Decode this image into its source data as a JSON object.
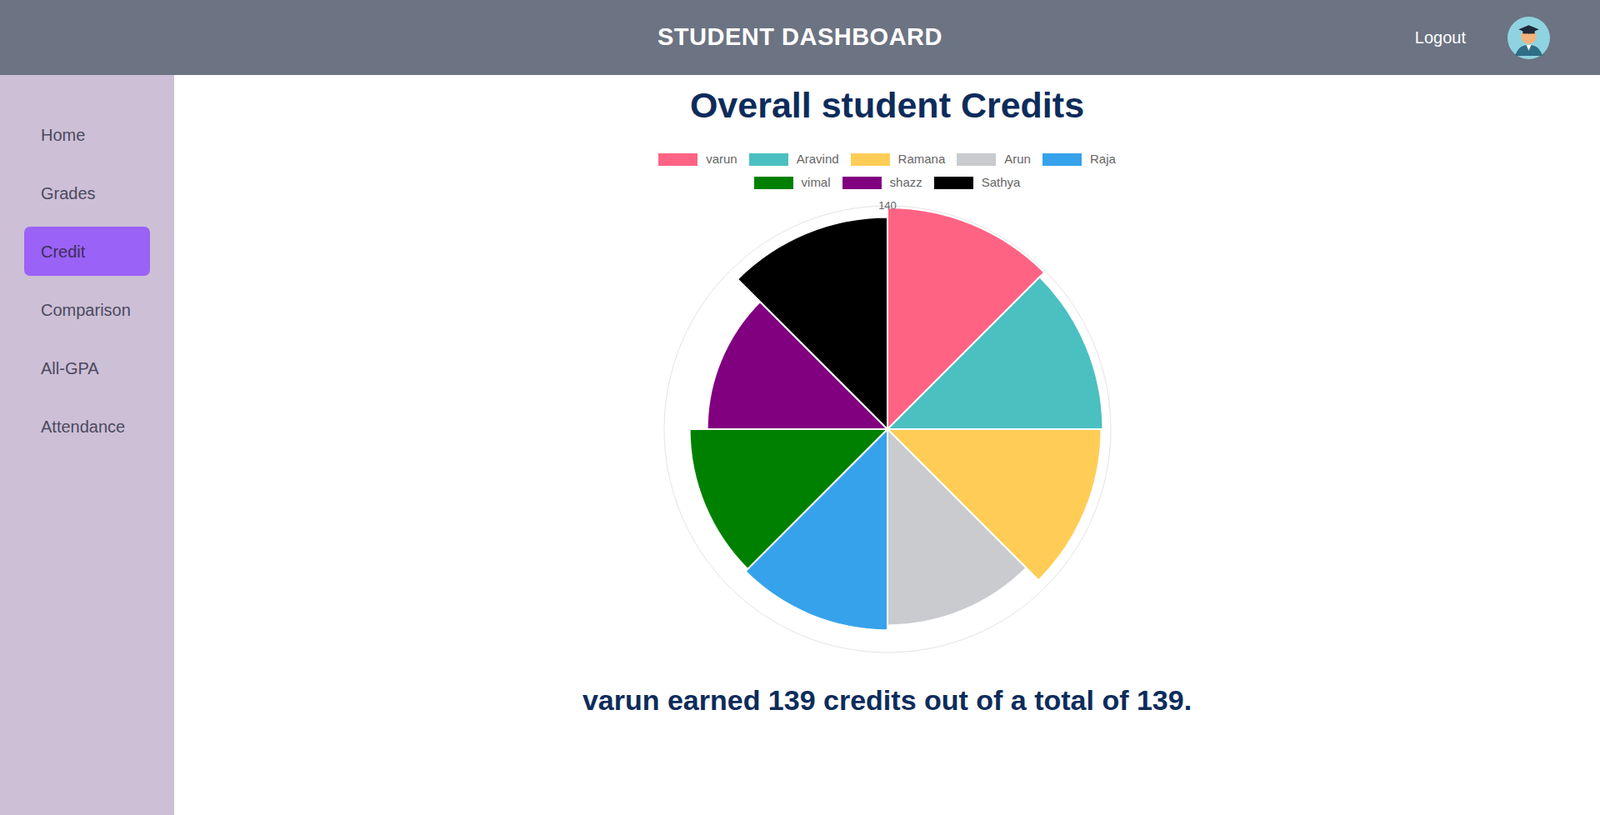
{
  "header": {
    "title": "STUDENT DASHBOARD",
    "logout": "Logout"
  },
  "sidebar": {
    "items": [
      {
        "label": "Home",
        "selected": false
      },
      {
        "label": "Grades",
        "selected": false
      },
      {
        "label": "Credit",
        "selected": true
      },
      {
        "label": "Comparison",
        "selected": false
      },
      {
        "label": "All-GPA",
        "selected": false
      },
      {
        "label": "Attendance",
        "selected": false
      }
    ]
  },
  "chart": {
    "title": "Overall student Credits",
    "ticks": [
      "140"
    ],
    "series": [
      {
        "label": "varun",
        "value": 139,
        "color": "#ff6384"
      },
      {
        "label": "Aravind",
        "value": 135,
        "color": "#4bc0c0"
      },
      {
        "label": "Ramana",
        "value": 134,
        "color": "#ffcd56"
      },
      {
        "label": "Arun",
        "value": 123,
        "color": "#c9cbcf"
      },
      {
        "label": "Raja",
        "value": 126,
        "color": "#36a2eb"
      },
      {
        "label": "vimal",
        "value": 124,
        "color": "#008000"
      },
      {
        "label": "shazz",
        "value": 113,
        "color": "#800080"
      },
      {
        "label": "Sathya",
        "value": 133,
        "color": "#000000"
      }
    ]
  },
  "summary": "varun earned 139 credits out of a total of 139."
}
